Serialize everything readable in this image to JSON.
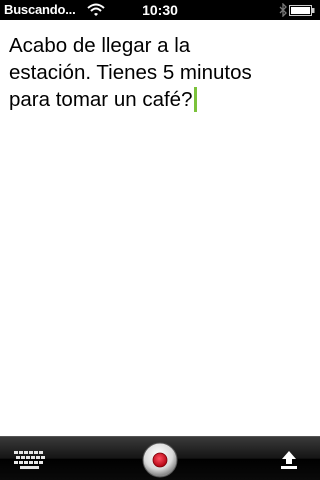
{
  "status_bar": {
    "carrier": "Buscando...",
    "time": "10:30",
    "icons": [
      "wifi-icon",
      "bluetooth-icon",
      "battery-icon"
    ]
  },
  "editor": {
    "text": "Acabo de llegar a la\nestación. Tienes 5 minutos\npara tomar un café?",
    "caret_color": "#7bc23b"
  },
  "toolbar": {
    "buttons": [
      "keyboard-icon",
      "record-icon",
      "upload-icon"
    ],
    "record_color": "#d0021b"
  }
}
